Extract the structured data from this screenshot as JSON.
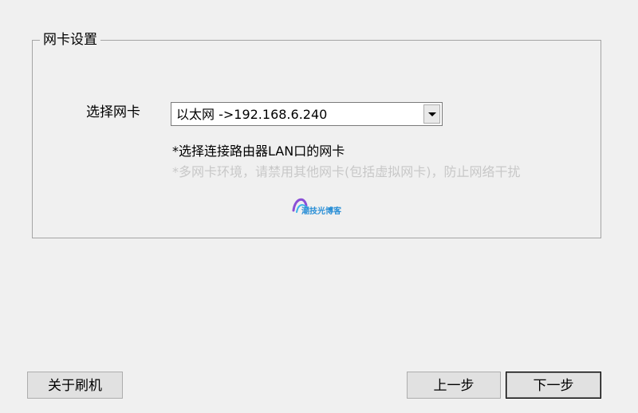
{
  "group": {
    "title": "网卡设置"
  },
  "nic": {
    "label": "选择网卡",
    "selected": "以太网 ->192.168.6.240",
    "hint": "*选择连接路由器LAN口的网卡",
    "warning": "*多网卡环境，请禁用其他网卡(包括虚拟网卡)，防止网络干扰"
  },
  "watermark": {
    "text": "潮技光博客"
  },
  "buttons": {
    "about": "关于刷机",
    "prev": "上一步",
    "next": "下一步"
  },
  "icons": {
    "dropdown": "chevron-down-icon",
    "watermark_logo": "watermark-logo"
  },
  "colors": {
    "background": "#f0f0f0",
    "border": "#a5a5a5",
    "disabled_text": "#c8c8c8"
  }
}
